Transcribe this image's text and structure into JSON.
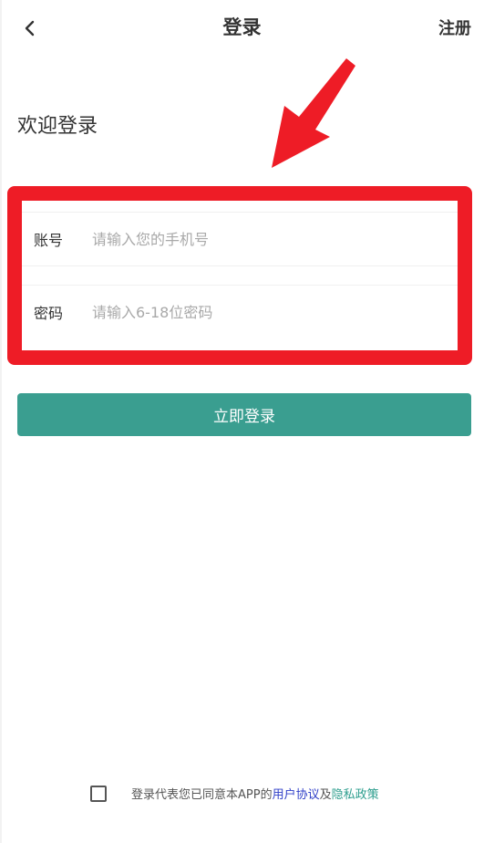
{
  "nav": {
    "back_icon": "chevron-left-icon",
    "title": "登录",
    "register_label": "注册"
  },
  "welcome": {
    "text": "欢迎登录"
  },
  "form": {
    "account": {
      "label": "账号",
      "placeholder": "请输入您的手机号",
      "value": ""
    },
    "password": {
      "label": "密码",
      "placeholder": "请输入6-18位密码",
      "value": ""
    }
  },
  "login_button": {
    "label": "立即登录"
  },
  "agreement": {
    "checked": false,
    "prefix": "登录代表您已同意本APP的",
    "user_agreement": "用户协议",
    "conjunction": "及",
    "privacy_policy": "隐私政策"
  },
  "annotation": {
    "arrow_icon": "red-arrow-icon",
    "highlight_color": "#ee1c26"
  },
  "colors": {
    "primary": "#3a9e90",
    "link_blue": "#2f3fc8",
    "link_green": "#2e9e8e"
  }
}
